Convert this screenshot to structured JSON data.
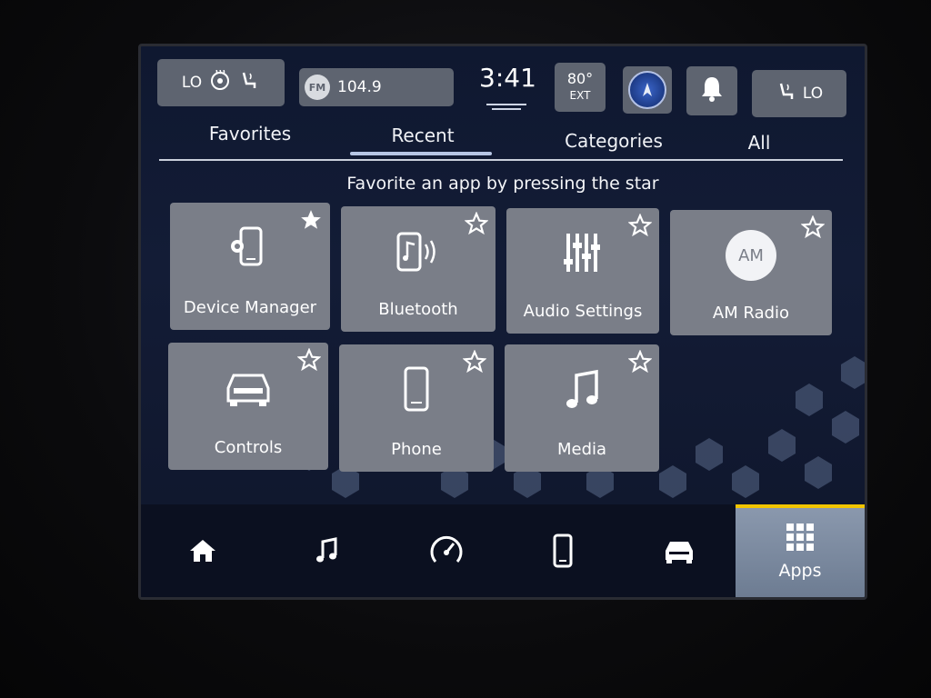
{
  "status_bar": {
    "seat_left_label": "LO",
    "radio_band": "FM",
    "radio_frequency": "104.9",
    "clock": "3:41",
    "temperature": "80°",
    "temperature_sub": "EXT",
    "seat_right_label": "LO"
  },
  "tabs": [
    {
      "label": "Favorites"
    },
    {
      "label": "Recent"
    },
    {
      "label": "Categories"
    },
    {
      "label": "All"
    }
  ],
  "hint": "Favorite an app by pressing the star",
  "apps": [
    {
      "label": "Device Manager",
      "icon": "device-manager-icon"
    },
    {
      "label": "Bluetooth",
      "icon": "bluetooth-icon"
    },
    {
      "label": "Audio Settings",
      "icon": "audio-settings-icon"
    },
    {
      "label": "AM Radio",
      "icon": "am-radio-icon",
      "badge": "AM"
    },
    {
      "label": "Controls",
      "icon": "controls-icon"
    },
    {
      "label": "Phone",
      "icon": "phone-icon"
    },
    {
      "label": "Media",
      "icon": "media-icon"
    }
  ],
  "bottom_bar": {
    "apps_label": "Apps",
    "items": [
      "home-icon",
      "music-icon",
      "performance-icon",
      "phone-icon",
      "vehicle-icon"
    ]
  },
  "colors": {
    "active_accent": "#f2c500",
    "tile": "#7a7e88",
    "status_box": "#5e6470"
  }
}
